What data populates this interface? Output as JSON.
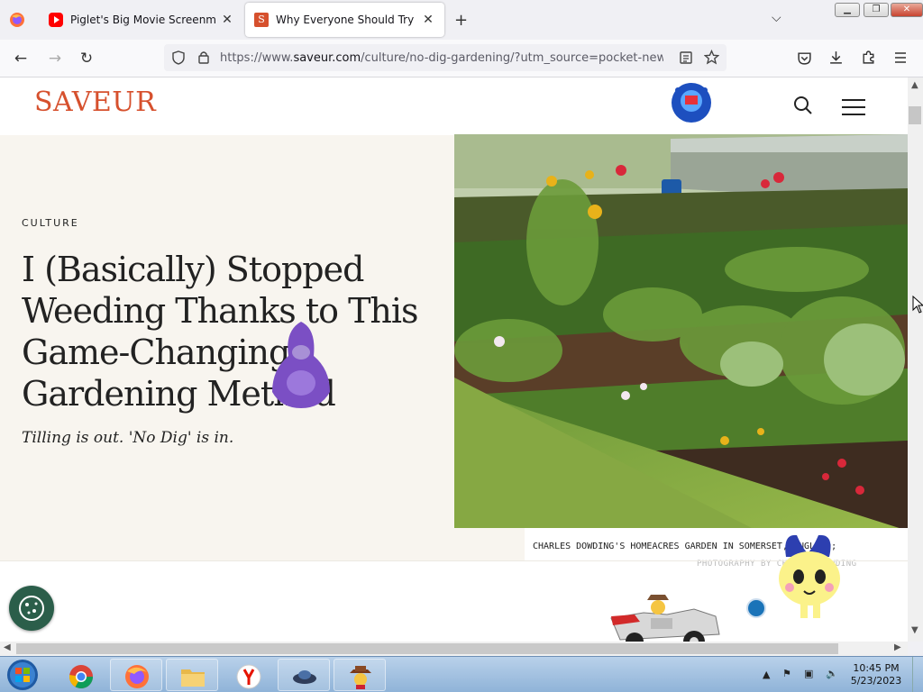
{
  "browser": {
    "tabs": [
      {
        "title": "Piglet's Big Movie Screenmate (",
        "icon": "youtube-icon",
        "active": false
      },
      {
        "title": "Why Everyone Should Try 'No D",
        "icon": "saveur-favicon",
        "active": true
      }
    ],
    "url": {
      "prefix": "https://www.",
      "domain": "saveur.com",
      "path": "/culture/no-dig-gardening/?utm_source=pocket-newtab"
    },
    "window_buttons": [
      "minimize",
      "restore",
      "close"
    ]
  },
  "page": {
    "logo": "SAVEUR",
    "category": "CULTURE",
    "headline": "I (Basically) Stopped Weeding Thanks to This Game-Changing Gardening Method",
    "dek": "Tilling is out. 'No Dig' is in.",
    "caption": "CHARLES DOWDING'S HOMEACRES GARDEN IN SOMERSET, ENGLAND;",
    "credit": "PHOTOGRAPHY BY CHARLES DOWDING"
  },
  "taskbar": {
    "time": "10:45 PM",
    "date": "5/23/2023",
    "apps": [
      "chrome",
      "firefox",
      "file-explorer",
      "yandex-browser",
      "screenmate-ufo",
      "screenmate-cowboy"
    ]
  },
  "colors": {
    "brand": "#d6502d",
    "hero_bg": "#f8f5ef",
    "cookie": "#2b5e4a"
  }
}
